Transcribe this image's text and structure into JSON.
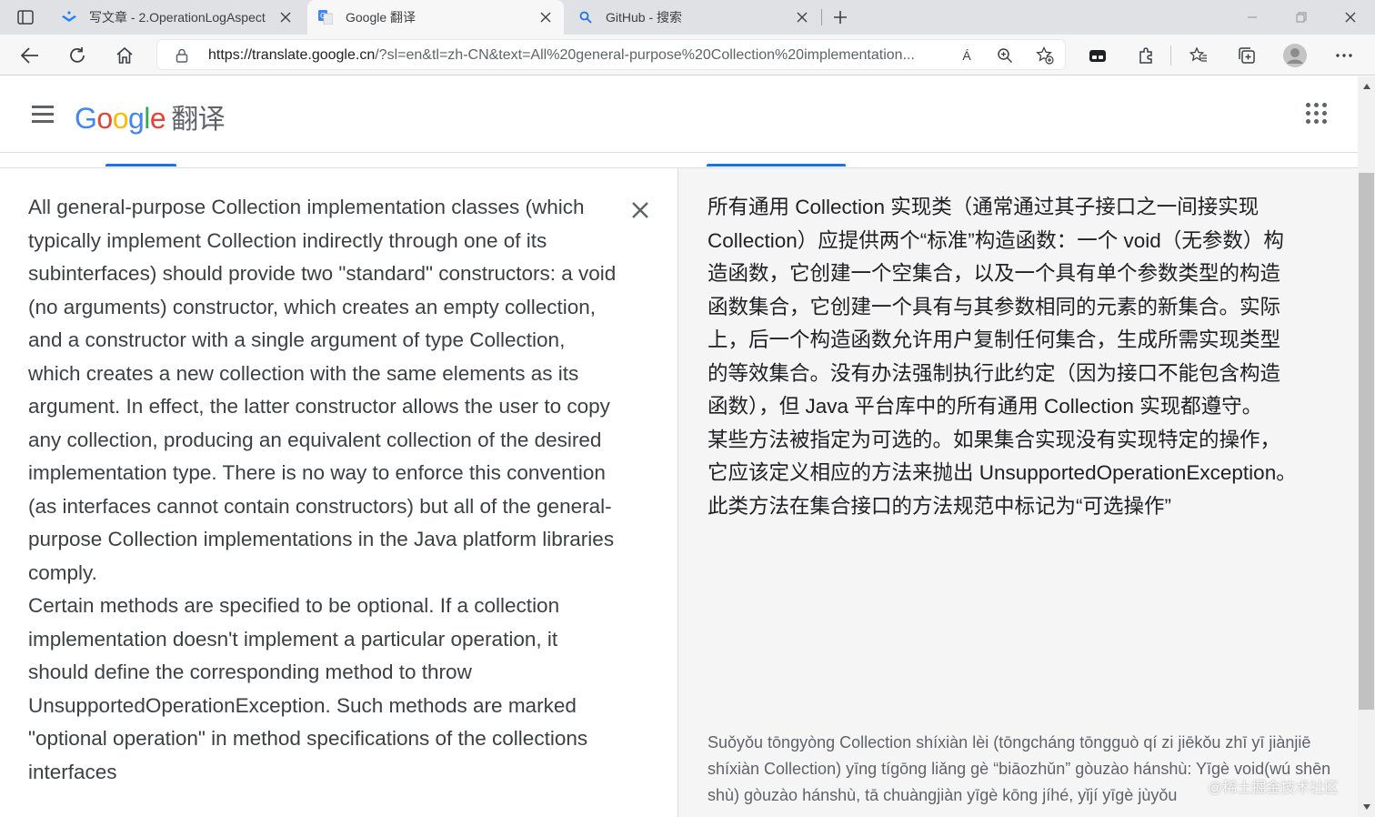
{
  "browser": {
    "tabs": [
      {
        "label": "写文章 - 2.OperationLogAspect",
        "icon": "juejin-icon",
        "active": false
      },
      {
        "label": "Google 翻译",
        "icon": "google-translate-icon",
        "active": true
      },
      {
        "label": "GitHub - 搜索",
        "icon": "search-icon",
        "active": false
      }
    ],
    "url_host": "https://translate.google.cn",
    "url_rest": "/?sl=en&tl=zh-CN&text=All%20general-purpose%20Collection%20implementation...",
    "read_aloud_glyph": "Á"
  },
  "page": {
    "logo_letters": [
      "G",
      "o",
      "o",
      "g",
      "l",
      "e"
    ],
    "product_name": "翻译",
    "source_text": "All general-purpose Collection implementation classes (which typically implement Collection indirectly through one of its subinterfaces) should provide two \"standard\" constructors: a void (no arguments) constructor, which creates an empty collection, and a constructor with a single argument of type Collection, which creates a new collection with the same elements as its argument. In effect, the latter constructor allows the user to copy any collection, producing an equivalent collection of the desired implementation type. There is no way to enforce this convention (as interfaces cannot contain constructors) but all of the general-purpose Collection implementations in the Java platform libraries comply.",
    "source_text_2": "Certain methods are specified to be optional. If a collection implementation doesn't implement a particular operation, it should define the corresponding method to throw UnsupportedOperationException. Such methods are marked \"optional operation\" in method specifications of the collections interfaces",
    "translation": "所有通用 Collection 实现类（通常通过其子接口之一间接实现 Collection）应提供两个“标准”构造函数：一个 void（无参数）构造函数，它创建一个空集合，以及一个具有单个参数类型的构造函数集合，它创建一个具有与其参数相同的元素的新集合。实际上，后一个构造函数允许用户复制任何集合，生成所需实现类型的等效集合。没有办法强制执行此约定（因为接口不能包含构造函数），但 Java 平台库中的所有通用 Collection 实现都遵守。",
    "translation_2": "某些方法被指定为可选的。如果集合实现没有实现特定的操作，它应该定义相应的方法来抛出 UnsupportedOperationException。此类方法在集合接口的方法规范中标记为“可选操作”",
    "transliteration": "Suǒyǒu tōngyòng Collection shíxiàn lèi (tōngcháng tōngguò qí zi jiēkǒu zhī yī jiànjiē shíxiàn Collection) yīng tígōng liǎng gè “biāozhǔn” gòuzào hánshù: Yīgè void(wú shēn shù) gòuzào hánshù, tā chuàngjiàn yīgè kōng jíhé, yǐjí yīgè jùyǒu",
    "watermark": "@稀土掘金技术社区"
  },
  "colors": {
    "accent": "#1a73e8",
    "target_bg": "#f5f5f5"
  }
}
